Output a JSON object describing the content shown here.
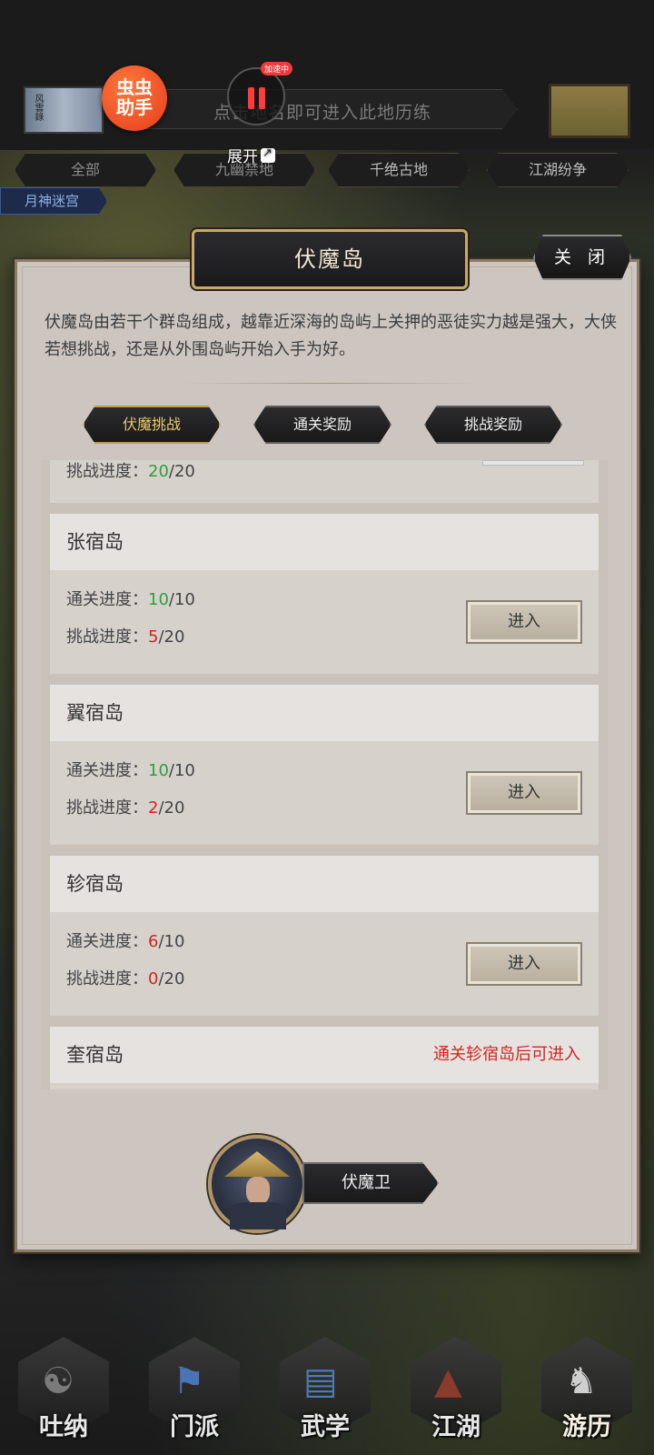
{
  "top": {
    "hint": "点击地名即可进入此地历练",
    "scroll_caption": "风雲錄",
    "assistant_logo": "虫虫\n助手",
    "speed_badge": "加速中",
    "expand_label": "展开"
  },
  "map_tabs": [
    "全部",
    "九幽禁地",
    "千绝古地",
    "江湖纷争"
  ],
  "map_label": "月神迷宫",
  "dialog": {
    "title": "伏魔岛",
    "close_label": "关 闭",
    "description": "伏魔岛由若干个群岛组成，越靠近深海的岛屿上关押的恶徒实力越是强大，大侠若想挑战，还是从外围岛屿开始入手为好。",
    "tabs": [
      "伏魔挑战",
      "通关奖励",
      "挑战奖励"
    ],
    "active_tab": "伏魔挑战",
    "progress_label_clear": "通关进度：",
    "progress_label_challenge": "挑战进度：",
    "enter_label": "进入",
    "partial_card": {
      "challenge_done": "20",
      "challenge_total": "/20"
    },
    "islands": [
      {
        "name": "张宿岛",
        "clear_done": "10",
        "clear_total": "/10",
        "challenge_done": "5",
        "challenge_total": "/20"
      },
      {
        "name": "翼宿岛",
        "clear_done": "10",
        "clear_total": "/10",
        "challenge_done": "2",
        "challenge_total": "/20"
      },
      {
        "name": "轸宿岛",
        "clear_done": "6",
        "clear_total": "/10",
        "challenge_done": "0",
        "challenge_total": "/20"
      }
    ],
    "locked_island": {
      "name": "奎宿岛",
      "requirement": "通关轸宿岛后可进入"
    },
    "npc_name": "伏魔卫"
  },
  "nav": [
    "吐纳",
    "门派",
    "武学",
    "江湖",
    "游历"
  ],
  "active_nav": "游历",
  "colors": {
    "complete": "#2fa03a",
    "incomplete": "#d0261f",
    "title_gold": "#c9a86a"
  }
}
